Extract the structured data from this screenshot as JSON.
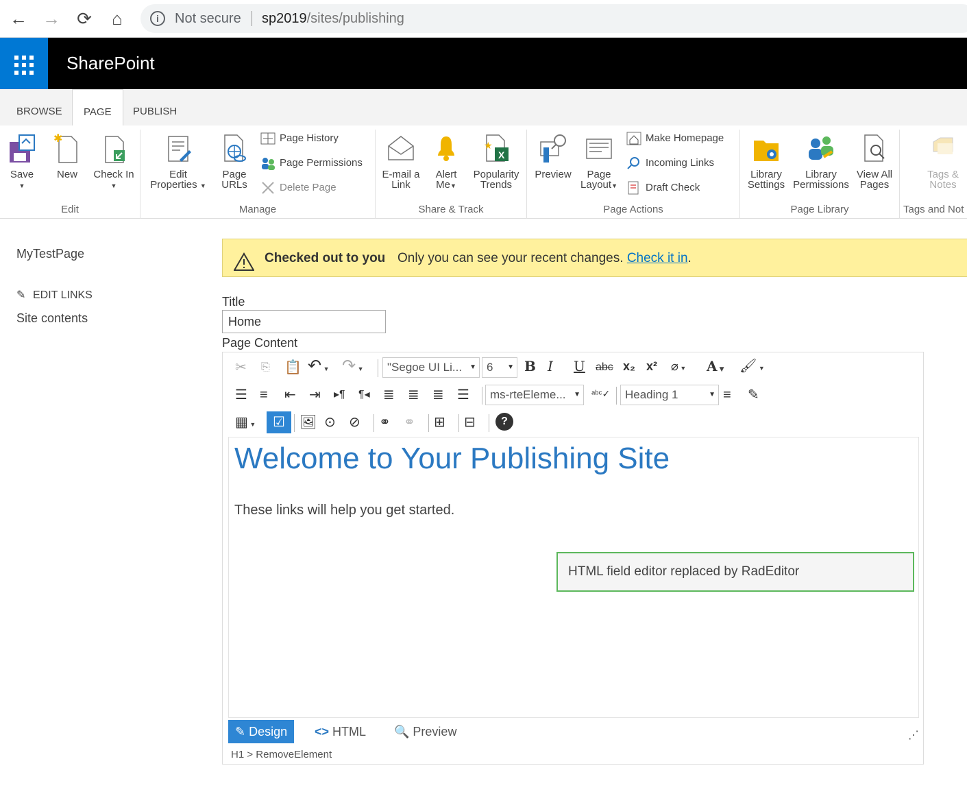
{
  "browser": {
    "back_icon": "←",
    "forward_icon": "→",
    "reload_icon": "⟳",
    "home_icon": "⌂",
    "info_icon": "i",
    "not_secure": "Not secure",
    "url_host": "sp2019",
    "url_path": "/sites/publishing"
  },
  "suite": {
    "brand": "SharePoint",
    "accent": "#0078d4"
  },
  "tabs": [
    {
      "label": "BROWSE"
    },
    {
      "label": "PAGE"
    },
    {
      "label": "PUBLISH"
    }
  ],
  "ribbon": {
    "edit": {
      "label": "Edit",
      "save": "Save",
      "new": "New",
      "checkin": "Check In"
    },
    "manage": {
      "label": "Manage",
      "edit_props_1": "Edit",
      "edit_props_2": "Properties",
      "page_urls_1": "Page",
      "page_urls_2": "URLs",
      "page_history": "Page History",
      "page_permissions": "Page Permissions",
      "delete_page": "Delete Page"
    },
    "share": {
      "label": "Share & Track",
      "email_1": "E-mail a",
      "email_2": "Link",
      "alert_1": "Alert",
      "alert_2": "Me",
      "pop_1": "Popularity",
      "pop_2": "Trends"
    },
    "actions": {
      "label": "Page Actions",
      "preview": "Preview",
      "layout_1": "Page",
      "layout_2": "Layout",
      "make_homepage": "Make Homepage",
      "incoming_links": "Incoming Links",
      "draft_check": "Draft Check"
    },
    "library": {
      "label": "Page Library",
      "settings_1": "Library",
      "settings_2": "Settings",
      "perms_1": "Library",
      "perms_2": "Permissions",
      "viewall_1": "View All",
      "viewall_2": "Pages"
    },
    "tags": {
      "label": "Tags and Not",
      "tags_1": "Tags &",
      "tags_2": "Notes"
    }
  },
  "leftnav": {
    "page": "MyTestPage",
    "edit_links": "EDIT LINKS",
    "site_contents": "Site contents"
  },
  "status": {
    "strong": "Checked out to you",
    "message": "Only you can see your recent changes.",
    "link": "Check it in",
    "after": "."
  },
  "form": {
    "title_label": "Title",
    "title_value": "Home",
    "content_label": "Page Content"
  },
  "editor": {
    "font_name": "\"Segoe UI Li...",
    "font_size": "6",
    "css_class": "ms-rteEleme...",
    "paragraph": "Heading 1",
    "heading": "Welcome to Your Publishing Site",
    "intro": "These links will help you get started.",
    "notice": "HTML field editor replaced by RadEditor",
    "modes": [
      "Design",
      "HTML",
      "Preview"
    ],
    "crumb": "H1 > RemoveElement"
  }
}
